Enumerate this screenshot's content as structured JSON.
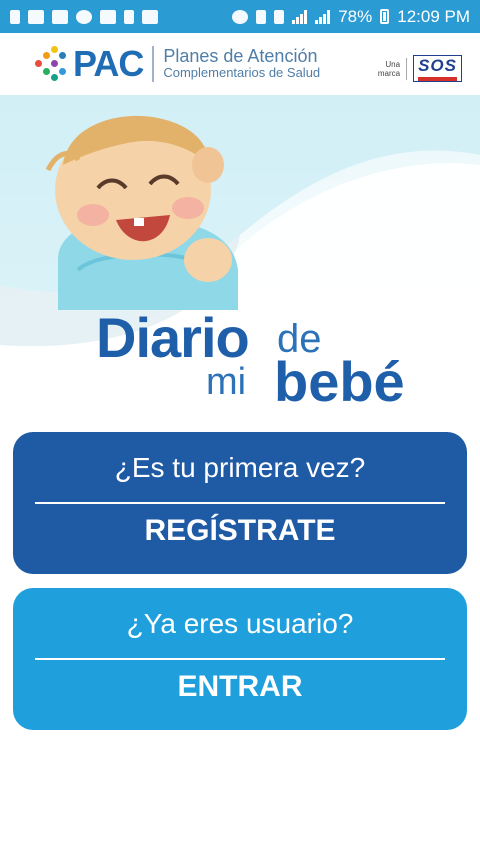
{
  "status_bar": {
    "battery_percent": "78%",
    "time": "12:09 PM"
  },
  "header": {
    "pac_logo": "PAC",
    "pac_line1": "Planes de Atención",
    "pac_line2": "Complementarios de Salud",
    "brand_prefix_1": "Una",
    "brand_prefix_2": "marca",
    "brand_logo": "SOS"
  },
  "hero": {
    "title_word1": "Diario",
    "title_word2": "de",
    "title_word3": "mi",
    "title_word4": "bebé"
  },
  "cards": {
    "first_time": {
      "question": "¿Es tu primera vez?",
      "action": "REGÍSTRATE"
    },
    "existing_user": {
      "question": "¿Ya eres usuario?",
      "action": "ENTRAR"
    }
  },
  "colors": {
    "status_bar": "#2a9bd3",
    "register_card": "#1f5aa4",
    "login_card": "#1f9fdc",
    "title_blue": "#1f5fa9"
  }
}
